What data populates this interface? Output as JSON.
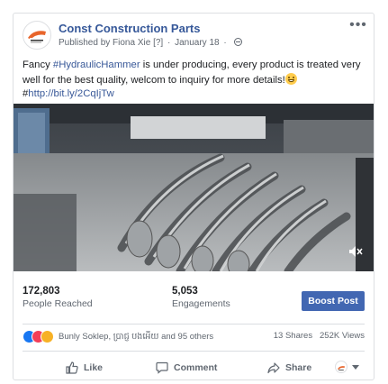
{
  "post": {
    "page_name": "Const Construction Parts",
    "published_by": "Published by Fiona Xie",
    "publisher_marker": "[?]",
    "date": "January 18",
    "separator": "·",
    "text_part1": "Fancy ",
    "hashtag": "#HydraulicHammer",
    "text_part2": " is under producing, every product is treated very well for the best quality, welcom to inquiry for more details!",
    "text_part3": "#",
    "link": "http://bit.ly/2CqIjTw"
  },
  "video": {
    "muted_icon": "speaker-muted-icon"
  },
  "stats": {
    "reached_value": "172,803",
    "reached_label": "People Reached",
    "engagements_value": "5,053",
    "engagements_label": "Engagements",
    "boost_label": "Boost Post"
  },
  "reactions": {
    "icons": [
      "like-reaction-icon",
      "love-reaction-icon",
      "haha-reaction-icon"
    ],
    "summary": "Bunly Soklep, ប្រាជ្ញ បងអើយ and 95 others",
    "shares": "13 Shares",
    "views": "252K Views"
  },
  "actions": {
    "like_label": "Like",
    "comment_label": "Comment",
    "share_label": "Share"
  },
  "colors": {
    "link": "#385898",
    "page_name": "#365899",
    "boost": "#4267b2",
    "like": "#1877f2",
    "love": "#f33e58",
    "haha": "#f7b125"
  }
}
